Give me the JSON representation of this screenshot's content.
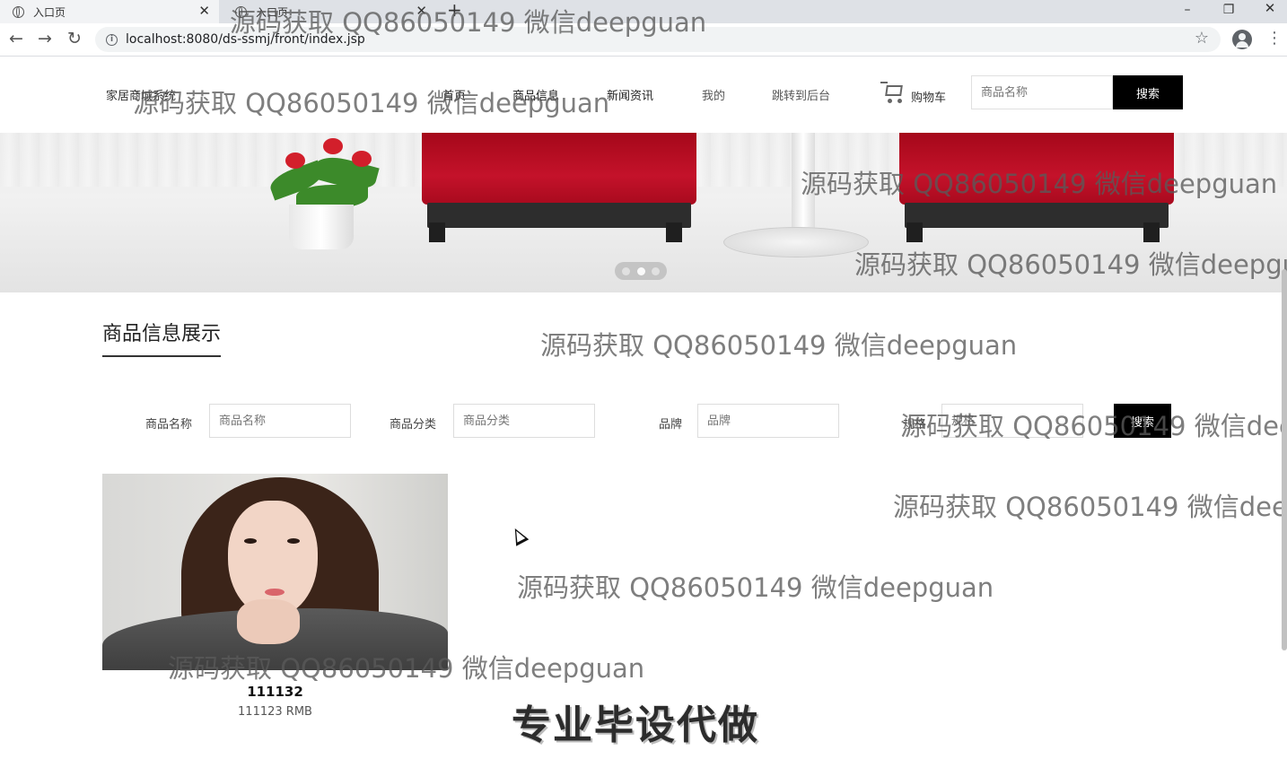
{
  "browser": {
    "tabs": [
      {
        "title": "入口页",
        "close": "✕"
      },
      {
        "title": "入口页",
        "close": "✕"
      }
    ],
    "new_tab": "+",
    "window_controls": {
      "minimize": "–",
      "restore": "❐",
      "close": "✕"
    },
    "nav": {
      "back": "←",
      "forward": "→",
      "reload": "↻"
    },
    "url": "localhost:8080/ds-ssmj/front/index.jsp",
    "info_glyph": "i",
    "star": "☆",
    "menu": "⋮"
  },
  "header": {
    "brand": "家居商城系统",
    "nav": [
      "首页",
      "商品信息",
      "新闻资讯",
      "我的",
      "跳转到后台"
    ],
    "cart_label": "购物车",
    "search_placeholder": "商品名称",
    "search_button": "搜索"
  },
  "banner": {
    "slide_count": 3,
    "active_slide": 2
  },
  "section": {
    "title": "商品信息展示"
  },
  "filters": {
    "fields": [
      {
        "label": "商品名称",
        "placeholder": "商品名称"
      },
      {
        "label": "商品分类",
        "placeholder": "商品分类"
      },
      {
        "label": "品牌",
        "placeholder": "品牌"
      },
      {
        "label": "规格",
        "placeholder": "规格"
      }
    ],
    "search_button": "搜索"
  },
  "products": [
    {
      "name": "111132",
      "price": "111123 RMB"
    }
  ],
  "overlay": {
    "watermark": "源码获取 QQ86050149 微信deepguan",
    "promo": "专业毕设代做"
  },
  "colors": {
    "button_bg": "#000000",
    "title_underline": "#333333",
    "chair_red": "#c4122a"
  }
}
